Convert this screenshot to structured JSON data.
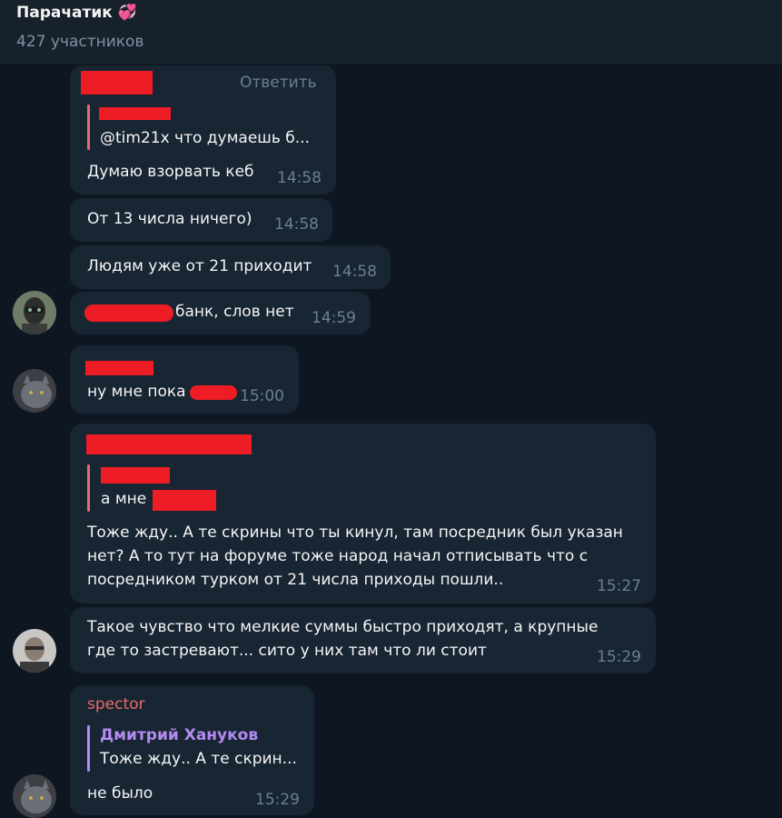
{
  "header": {
    "title": "Парачатик 💞",
    "subtitle": "427 участников"
  },
  "messages": [
    {
      "reply_label": "Ответить",
      "quote_text": "@tim21x что думаешь б...",
      "text": "Думаю взорвать кеб",
      "time": "14:58"
    },
    {
      "text": "От 13 числа ничего)",
      "time": "14:58"
    },
    {
      "text": "Людям уже от 21 приходит",
      "time": "14:58"
    },
    {
      "text": "банк, слов нет",
      "time": "14:59"
    },
    {
      "text": "ну мне пока",
      "time": "15:00"
    },
    {
      "quote_text": "а мне",
      "lines": [
        "Тоже жду.. А те скрины что ты кинул, там посредник был указан",
        "нет? А то тут на форуме тоже народ начал отписывать что с",
        "посредником турком от 21 числа приходы пошли.."
      ],
      "time": "15:27"
    },
    {
      "lines": [
        "Такое чувство что мелкие суммы быстро приходят, а крупные",
        "где то застревают... сито у них там что ли стоит"
      ],
      "time": "15:29"
    },
    {
      "sender": "spector",
      "quote_author": "Дмитрий Хануков",
      "quote_text": "Тоже жду.. А те скрин...",
      "text": "не было",
      "time": "15:29"
    }
  ],
  "colors": {
    "background": "#0e1621",
    "bubble": "#182533",
    "spector": "#e86a6a",
    "quote_author": "#b48bf0",
    "redaction": "#ee1c25"
  }
}
